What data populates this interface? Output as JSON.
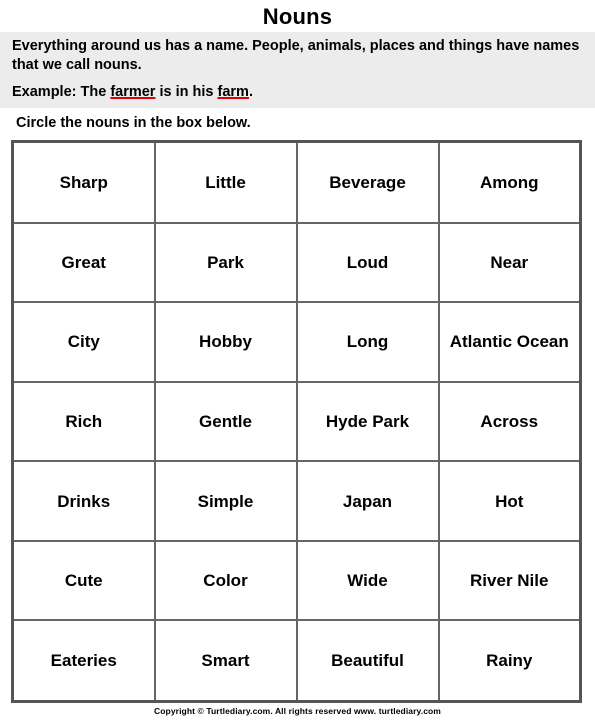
{
  "worksheet": {
    "title": "Nouns",
    "instruction": {
      "paragraph": "Everything around us has a name. People, animals, places and things have names that we call nouns.",
      "example_prefix": "Example: The ",
      "example_word1": "farmer",
      "example_middle": " is in his ",
      "example_word2": "farm",
      "example_suffix": ".",
      "underline_color": "#e00000",
      "panel_bg": "#ececec"
    },
    "task": "Circle the nouns in the box below.",
    "grid": {
      "columns": 4,
      "rows": 7,
      "cells": [
        [
          "Sharp",
          "Little",
          "Beverage",
          "Among"
        ],
        [
          "Great",
          "Park",
          "Loud",
          "Near"
        ],
        [
          "City",
          "Hobby",
          "Long",
          "Atlantic Ocean"
        ],
        [
          "Rich",
          "Gentle",
          "Hyde Park",
          "Across"
        ],
        [
          "Drinks",
          "Simple",
          "Japan",
          "Hot"
        ],
        [
          "Cute",
          "Color",
          "Wide",
          "River Nile"
        ],
        [
          "Eateries",
          "Smart",
          "Beautiful",
          "Rainy"
        ]
      ],
      "border_color": "#555555",
      "grid_line_color": "#666666"
    },
    "footer": "Copyright © Turtlediary.com. All rights reserved  www. turtlediary.com"
  }
}
